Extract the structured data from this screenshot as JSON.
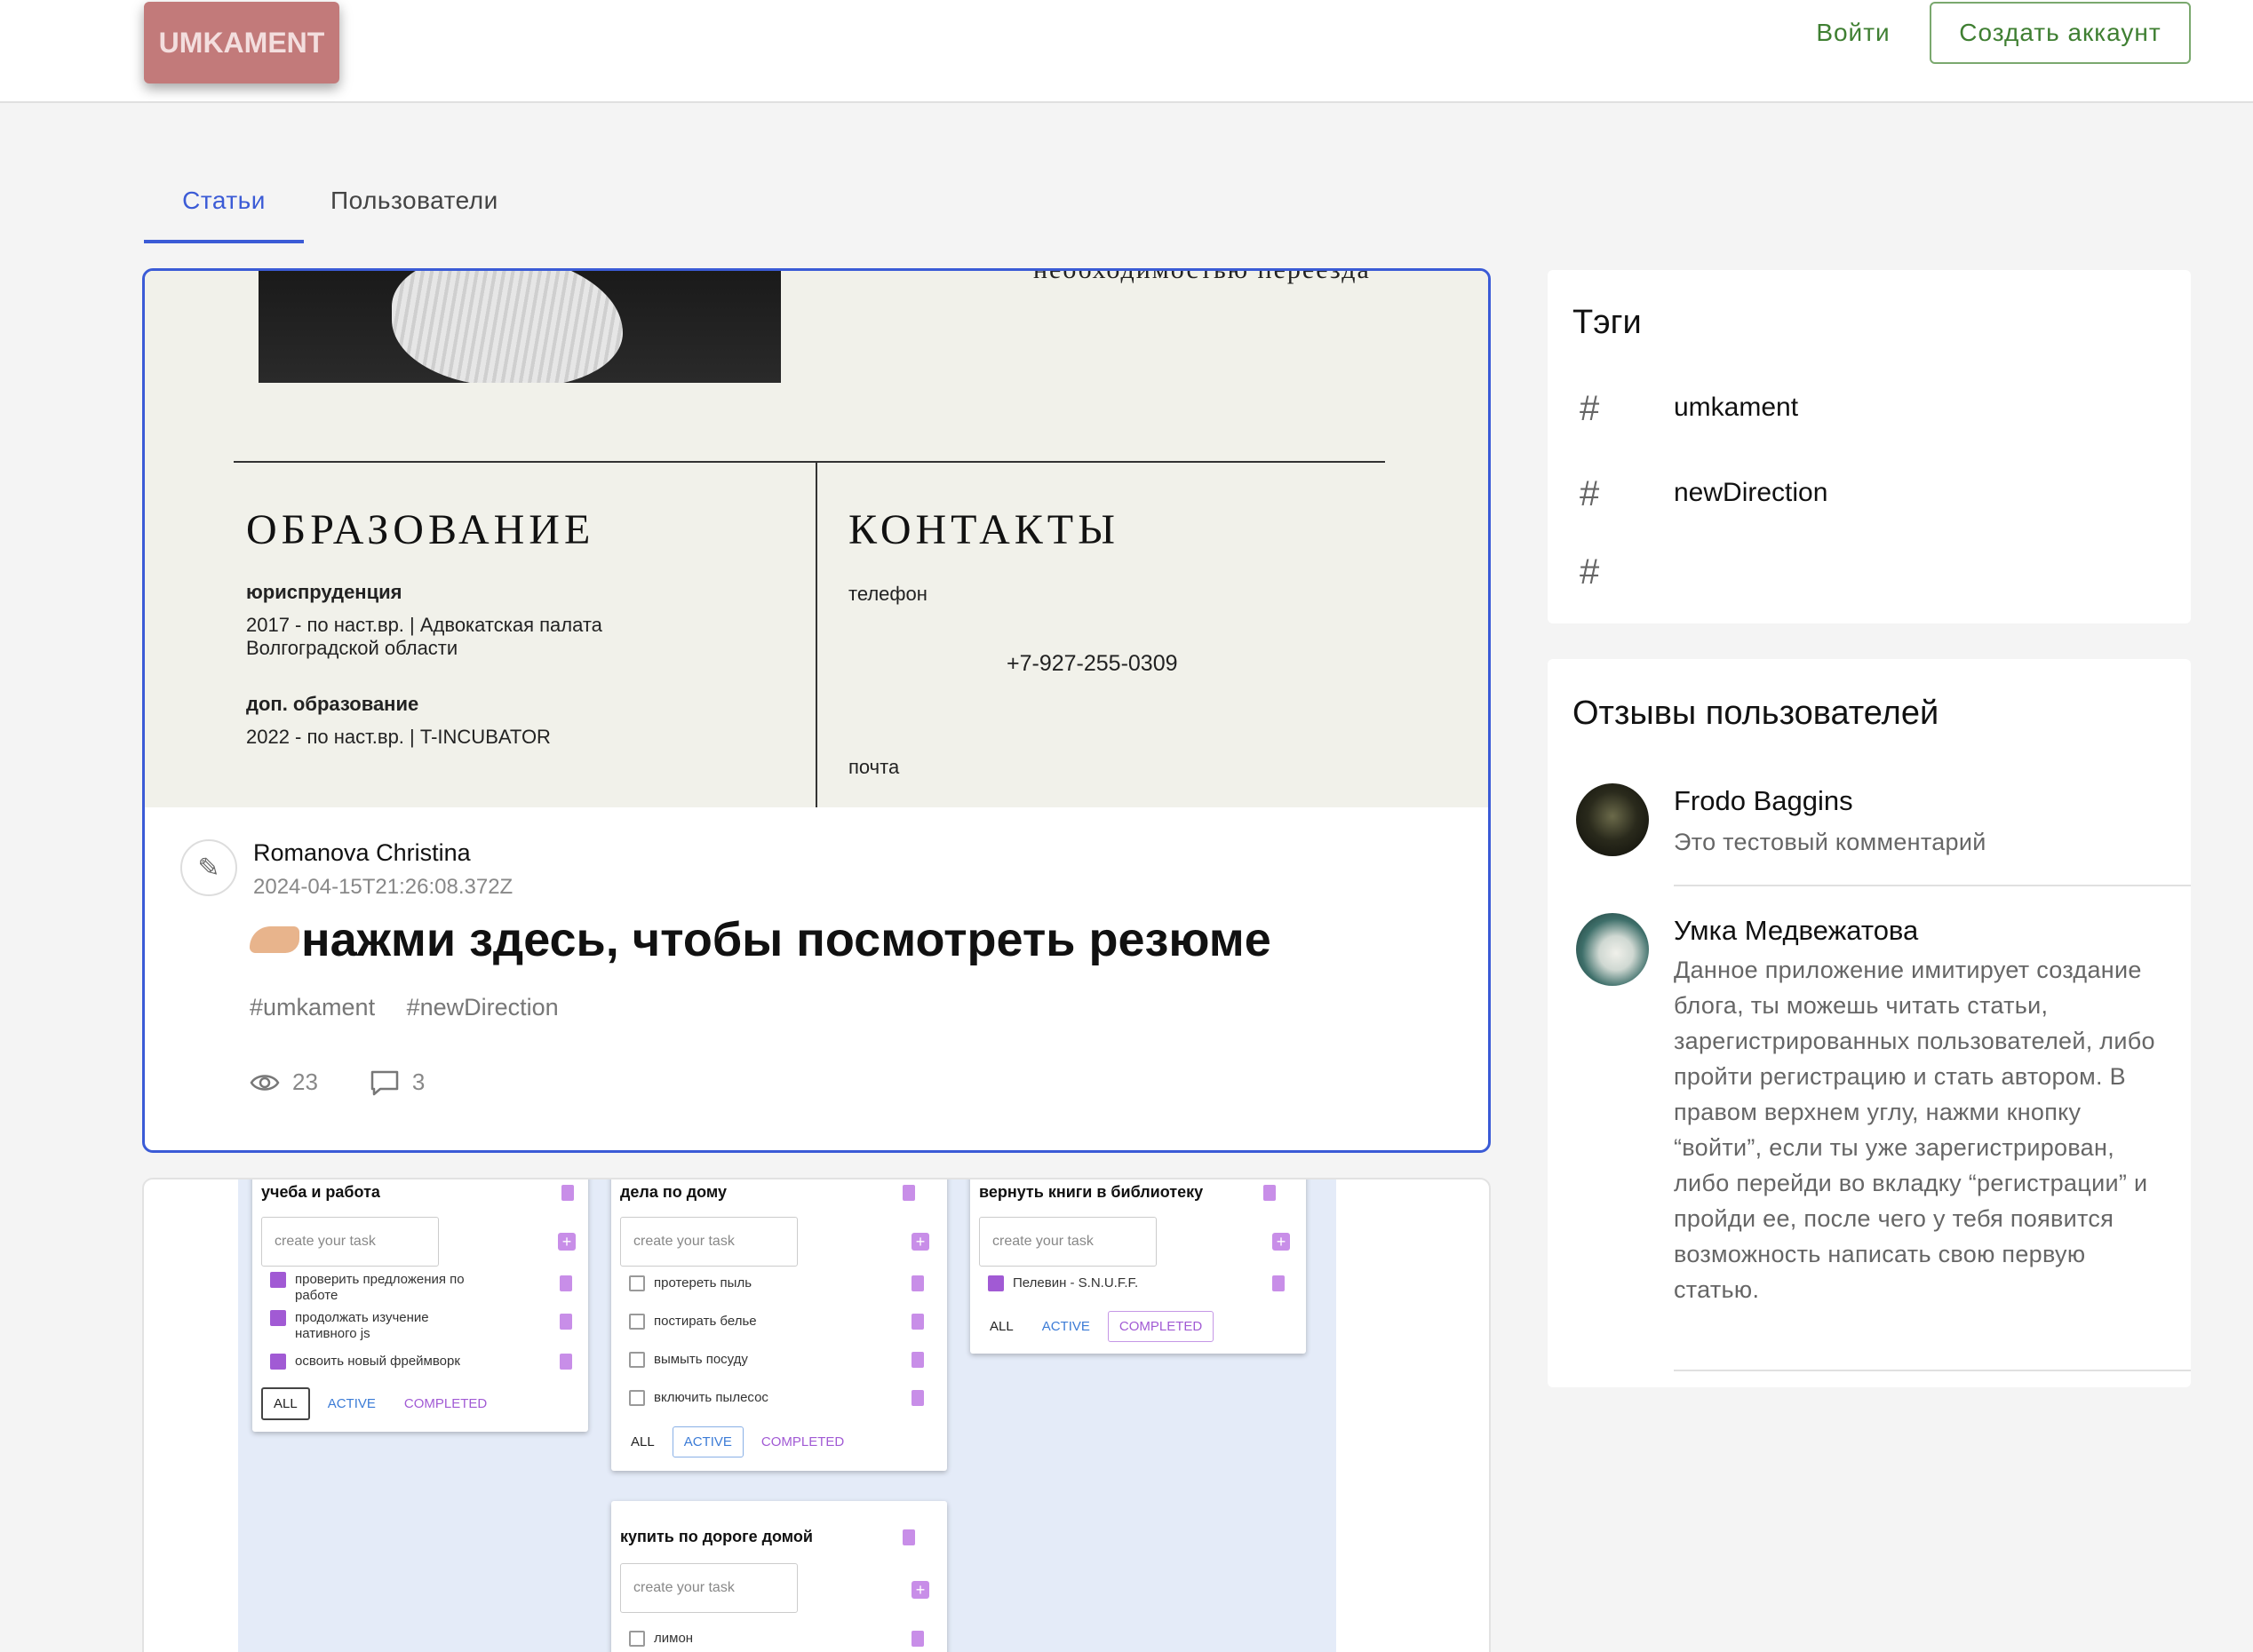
{
  "header": {
    "logo": "UMKAMENT",
    "login_label": "Войти",
    "signup_label": "Создать аккаунт"
  },
  "tabs": [
    {
      "label": "Статьи",
      "active": true
    },
    {
      "label": "Пользователи",
      "active": false
    }
  ],
  "article1": {
    "image": {
      "top_text": "необходимостью переезда",
      "education_title": "ОБРАЗОВАНИЕ",
      "contacts_title": "КОНТАКТЫ",
      "edu1_head": "юриспруденция",
      "edu1_line1": "2017 - по наст.вр. | Адвокатская палата",
      "edu1_line2": "Волгоградской области",
      "edu2_head": "доп. образование",
      "edu2_line1": "2022 -  по наст.вр. | T-INCUBATOR",
      "phone_label": "телефон",
      "phone": "+7-927-255-0309",
      "mail_label": "почта"
    },
    "author": "Romanova Christina",
    "date": "2024-04-15T21:26:08.372Z",
    "title": "нажми здесь, чтобы посмотреть резюме",
    "tags": [
      "#umkament",
      "#newDirection"
    ],
    "views": "23",
    "comments": "3"
  },
  "article2": {
    "lists": [
      {
        "title": "учеба и работа",
        "placeholder": "create your task",
        "items": [
          {
            "text": "проверить предложения по работе",
            "done": true
          },
          {
            "text": "продолжать изучение нативного js",
            "done": true
          },
          {
            "text": "освоить новый фреймворк",
            "done": true
          }
        ]
      },
      {
        "title": "дела по дому",
        "placeholder": "create your task",
        "items": [
          {
            "text": "протереть пыль",
            "done": false
          },
          {
            "text": "постирать белье",
            "done": false
          },
          {
            "text": "вымыть посуду",
            "done": false
          },
          {
            "text": "включить пылесос",
            "done": false
          }
        ]
      },
      {
        "title": "вернуть книги в библиотеку",
        "placeholder": "create your task",
        "items": [
          {
            "text": "Пелевин - S.N.U.F.F.",
            "done": true
          }
        ]
      },
      {
        "title": "купить по дороге домой",
        "placeholder": "create your task",
        "items": [
          {
            "text": "лимон",
            "done": false
          }
        ]
      }
    ],
    "filters": {
      "all": "ALL",
      "active": "ACTIVE",
      "completed": "COMPLETED"
    }
  },
  "sidebar": {
    "tags_title": "Тэги",
    "tags": [
      "umkament",
      "newDirection",
      ""
    ],
    "reviews_title": "Отзывы пользователей",
    "reviews": [
      {
        "name": "Frodo Baggins",
        "text": "Это тестовый комментарий"
      },
      {
        "name": "Умка Медвежатова",
        "text": "Данное приложение имитирует создание блога, ты можешь читать статьи, зарегистрированных пользователей, либо пройти регистрацию и стать автором. В правом верхнем углу, нажми кнопку “войти”, если ты уже зарегистрирован, либо перейди во вкладку “регистрации” и пройди ее, после чего у тебя появится возможность написать свою первую статью."
      }
    ]
  },
  "colors": {
    "accent": "#3b5bd6",
    "brand": "#c27a7a",
    "green": "#3f7f32"
  }
}
